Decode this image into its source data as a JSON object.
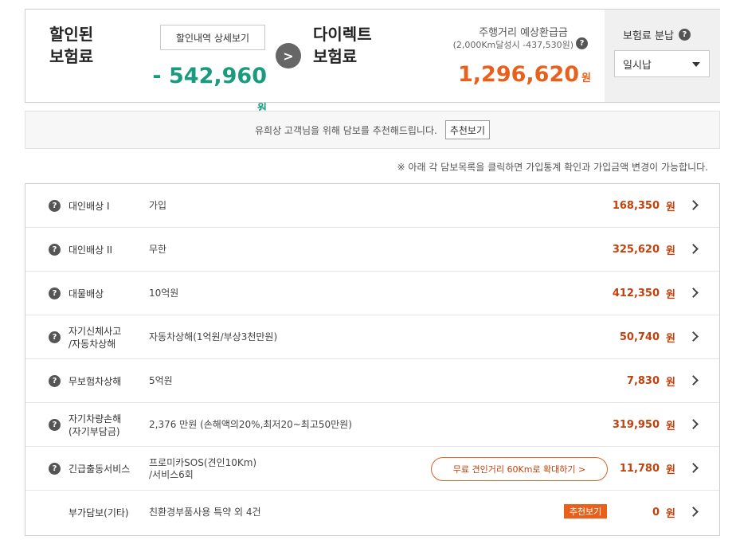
{
  "summary": {
    "discount_label": "할인된\n보험료",
    "detail_button": "할인내역 상세보기",
    "discount_amount": "- 542,960",
    "discount_unit": "원",
    "direct_label": "다이렉트\n보험료",
    "refund_title": "주행거리 예상환급금",
    "refund_sub": "(2,000Km달성시 -437,530원)",
    "direct_amount": "1,296,620",
    "direct_unit": "원",
    "payment_label": "보험료 분납",
    "payment_selected": "일시납",
    "help_glyph": "?",
    "arrow_glyph": ">"
  },
  "recommend": {
    "text": "유희상 고객님을 위해 담보를 추천해드립니다.",
    "button": "추천보기"
  },
  "notice": "※ 아래 각 담보목록을 클릭하면 가입통계 확인과 가입금액 변경이 가능합니다.",
  "coverages": [
    {
      "name": "대인배상 I",
      "detail": "가입",
      "amount": "168,350",
      "unit": "원"
    },
    {
      "name": "대인배상 II",
      "detail": "무한",
      "amount": "325,620",
      "unit": "원"
    },
    {
      "name": "대물배상",
      "detail": "10억원",
      "amount": "412,350",
      "unit": "원"
    },
    {
      "name": "자기신체사고\n/자동차상해",
      "detail": "자동차상해(1억원/부상3천만원)",
      "amount": "50,740",
      "unit": "원"
    },
    {
      "name": "무보험차상해",
      "detail": "5억원",
      "amount": "7,830",
      "unit": "원"
    },
    {
      "name": "자기차량손해\n(자기부담금)",
      "detail": "2,376 만원 (손해액의20%,최저20~최고50만원)",
      "amount": "319,950",
      "unit": "원"
    },
    {
      "name": "긴급출동서비스",
      "detail": "프로미카SOS(견인10Km)\n/서비스6회",
      "amount": "11,780",
      "unit": "원",
      "action": "무료 견인거리 60Km로 확대하기 >"
    },
    {
      "name": "부가담보(기타)",
      "detail": "친환경부품사용 특약 외 4건",
      "amount": "0",
      "unit": "원",
      "badge": "추천보기"
    }
  ],
  "colors": {
    "discount": "#1a9a7e",
    "price": "#e8601c",
    "amount": "#c2410c"
  }
}
